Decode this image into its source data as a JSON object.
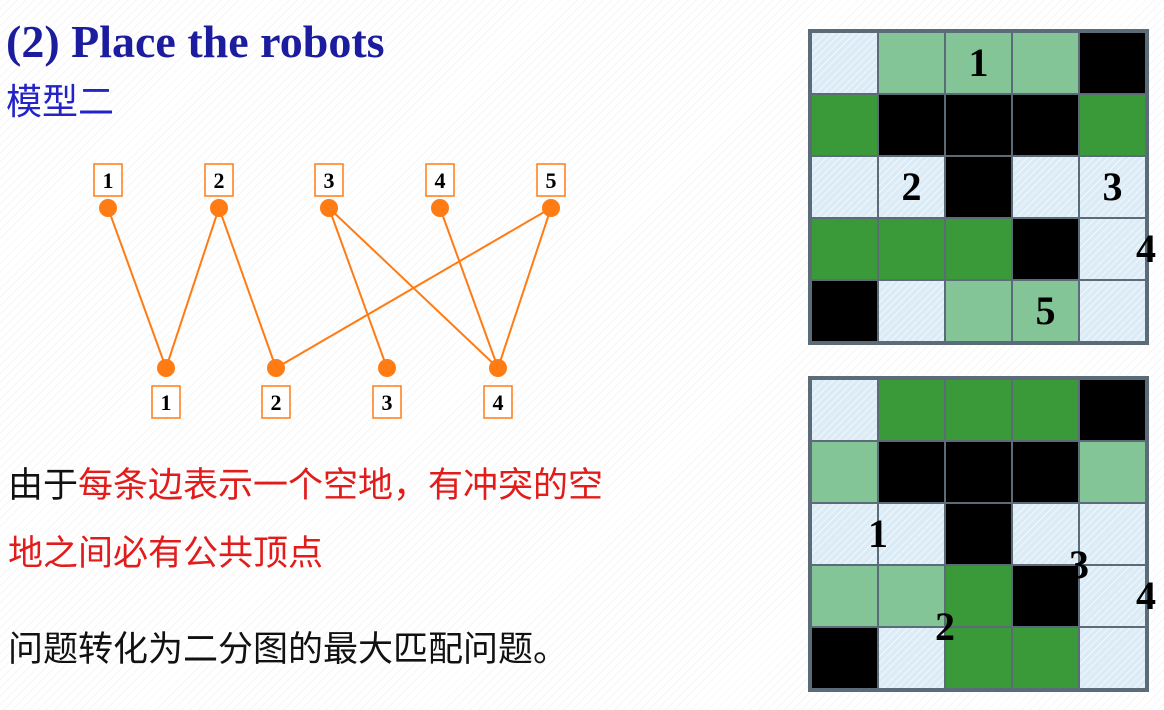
{
  "title": "(2) Place the robots",
  "subtitle": "模型二",
  "paragraph1_black": "由于",
  "paragraph1_red": "每条边表示一个空地，有冲突的空",
  "paragraph2": "地之间必有公共顶点",
  "paragraph3": "问题转化为二分图的最大匹配问题。",
  "graph": {
    "top_nodes": [
      {
        "label": "1"
      },
      {
        "label": "2"
      },
      {
        "label": "3"
      },
      {
        "label": "4"
      },
      {
        "label": "5"
      }
    ],
    "bottom_nodes": [
      {
        "label": "1"
      },
      {
        "label": "2"
      },
      {
        "label": "3"
      },
      {
        "label": "4"
      }
    ],
    "edges": [
      [
        1,
        1
      ],
      [
        2,
        1
      ],
      [
        2,
        2
      ],
      [
        3,
        3
      ],
      [
        3,
        4
      ],
      [
        4,
        4
      ],
      [
        5,
        2
      ],
      [
        5,
        4
      ]
    ],
    "color": "#ff7b14"
  },
  "grid_top": {
    "cells": [
      [
        "W",
        "L",
        "L",
        "L",
        "B"
      ],
      [
        "G",
        "B",
        "B",
        "B",
        "G"
      ],
      [
        "W",
        "W",
        "B",
        "W",
        "W"
      ],
      [
        "G",
        "G",
        "G",
        "B",
        "W"
      ],
      [
        "B",
        "W",
        "L",
        "L",
        "W"
      ]
    ],
    "labels": [
      {
        "text": "1",
        "row": 0,
        "col": 2
      },
      {
        "text": "2",
        "row": 2,
        "col": 1
      },
      {
        "text": "3",
        "row": 2,
        "col": 4
      },
      {
        "text": "4",
        "row": 3,
        "col": 4.5
      },
      {
        "text": "5",
        "row": 4,
        "col": 3
      }
    ]
  },
  "grid_bottom": {
    "cells": [
      [
        "W",
        "G",
        "G",
        "G",
        "B"
      ],
      [
        "L",
        "B",
        "B",
        "B",
        "L"
      ],
      [
        "W",
        "W",
        "B",
        "W",
        "W"
      ],
      [
        "L",
        "L",
        "G",
        "B",
        "W"
      ],
      [
        "B",
        "W",
        "G",
        "G",
        "W"
      ]
    ],
    "labels": [
      {
        "text": "1",
        "row": 2,
        "col": 0.5
      },
      {
        "text": "2",
        "row": 3.5,
        "col": 1.5
      },
      {
        "text": "3",
        "row": 2.5,
        "col": 3.5
      },
      {
        "text": "4",
        "row": 3,
        "col": 4.5
      }
    ]
  },
  "colors": {
    "title": "#1c1c9e",
    "subtitle": "#2323c8",
    "red_text": "#e21b1b",
    "black": "#000000",
    "dark_green": "#3a9a3a",
    "light_green": "#83c597",
    "light_blue": "#dcecf7",
    "grid_border": "#5b6b78"
  }
}
